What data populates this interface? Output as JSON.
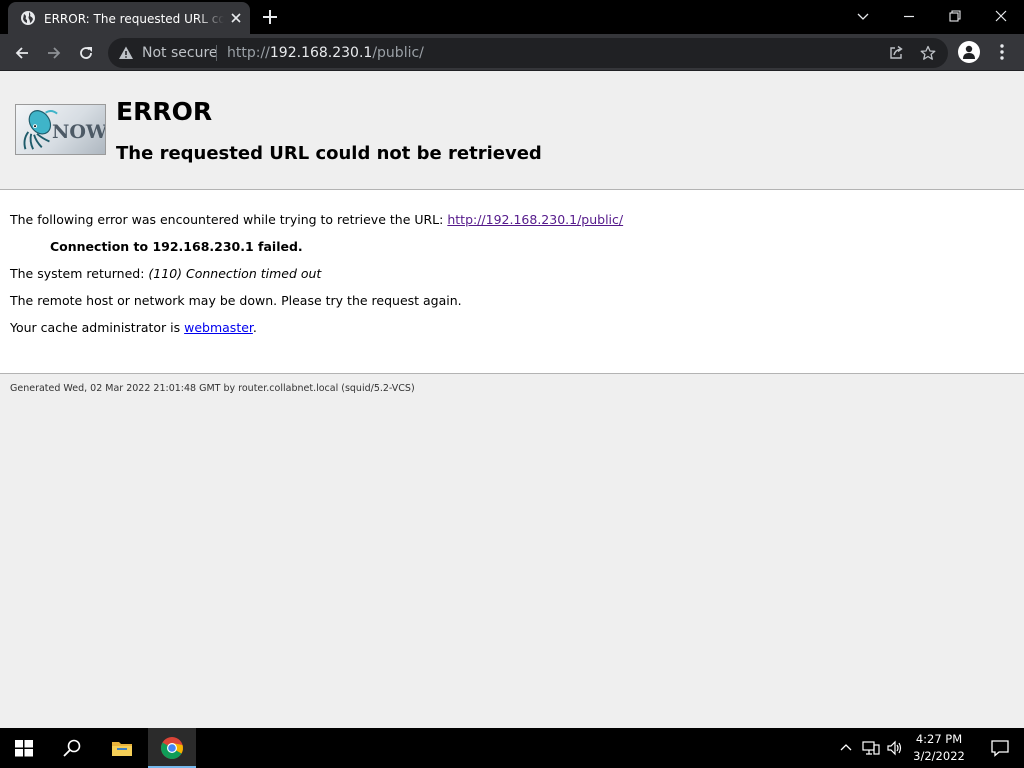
{
  "browser": {
    "tab_title": "ERROR: The requested URL could not be retrieved",
    "security_label": "Not secure",
    "url_prefix": "http://",
    "url_host": "192.168.230.1",
    "url_path": "/public/"
  },
  "page": {
    "logo_text": "NOW",
    "heading": "ERROR",
    "subheading": "The requested URL could not be retrieved",
    "line1_prefix": "The following error was encountered while trying to retrieve the URL: ",
    "line1_link": "http://192.168.230.1/public/",
    "line2": "Connection to 192.168.230.1 failed.",
    "line3_prefix": "The system returned: ",
    "line3_error": "(110) Connection timed out",
    "line4": "The remote host or network may be down. Please try the request again.",
    "line5_prefix": "Your cache administrator is ",
    "line5_link": "webmaster",
    "line5_suffix": ".",
    "footer": "Generated Wed, 02 Mar 2022 21:01:48 GMT by router.collabnet.local (squid/5.2-VCS)"
  },
  "taskbar": {
    "time": "4:27 PM",
    "date": "3/2/2022"
  },
  "colors": {
    "link": "#0000ee",
    "visited_link": "#551a8b",
    "chrome_dark": "#35363a",
    "taskbar": "#000000"
  }
}
